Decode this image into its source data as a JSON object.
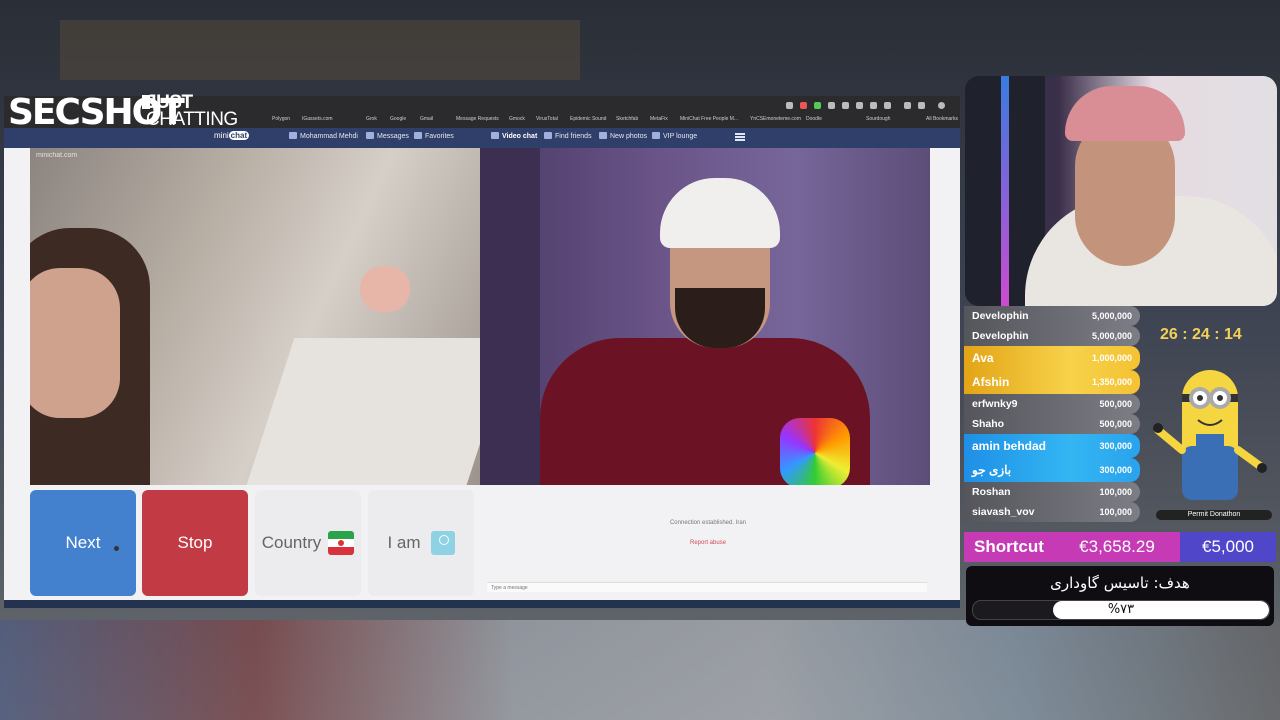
{
  "stream": {
    "logo_main": "SECSHOT",
    "logo_category_line1": "JUST",
    "logo_category_line2": "CHATTING"
  },
  "browser": {
    "bookmarks": [
      "Polygon",
      "IGassets.com",
      "Grok",
      "Google",
      "Gmail",
      "Message Requests",
      "Gmock",
      "VirusTotal",
      "Epidemic Sound",
      "Sketchfab",
      "MetaFix",
      "MiniChat Free People M...",
      "YnCSEmoneteme.com",
      "Doodle",
      "Sourdough",
      "All Bookmarks"
    ],
    "site_logo_pre": "mini",
    "site_logo_post": "chat",
    "nav": {
      "user": "Mohammad Mehdi",
      "messages": "Messages",
      "favorites": "Favorites",
      "video_chat": "Video chat",
      "find_friends": "Find friends",
      "new_photos": "New photos",
      "vip_lounge": "VIP lounge"
    },
    "watermark": "minichat.com",
    "controls": {
      "next": "Next",
      "stop": "Stop",
      "country": "Country",
      "iam": "I am"
    },
    "chat": {
      "status": "Connection established. Iran",
      "report": "Report abuse",
      "placeholder": "Type a message"
    }
  },
  "donors": [
    {
      "name": "Develophin",
      "amount": "5,000,000",
      "tier": "grey"
    },
    {
      "name": "Develophin",
      "amount": "5,000,000",
      "tier": "grey"
    },
    {
      "name": "Ava",
      "amount": "1,000,000",
      "tier": "gold"
    },
    {
      "name": "Afshin",
      "amount": "1,350,000",
      "tier": "gold"
    },
    {
      "name": "erfwnky9",
      "amount": "500,000",
      "tier": "grey"
    },
    {
      "name": "Shaho",
      "amount": "500,000",
      "tier": "grey"
    },
    {
      "name": "amin behdad",
      "amount": "300,000",
      "tier": "blue"
    },
    {
      "name": "بازی جو",
      "amount": "300,000",
      "tier": "blue"
    },
    {
      "name": "Roshan",
      "amount": "100,000",
      "tier": "grey"
    },
    {
      "name": "siavash_vov",
      "amount": "100,000",
      "tier": "grey"
    }
  ],
  "timer": "26 : 24 : 14",
  "marathon_label": "Permit Donathon",
  "shortcut": {
    "label": "Shortcut",
    "amount": "€3,658.29",
    "goal": "€5,000"
  },
  "goal": {
    "title": "هدف: تاسیس گاوداری",
    "percent_label": "%۷۳",
    "progress": 0.73
  },
  "colors": {
    "next_button": "#4381cf",
    "stop_button": "#c23a44",
    "site_nav": "#2f3f6a",
    "gold_donor": "#f2c232",
    "blue_donor": "#29a3ec",
    "shortcut_pink": "#c63ab6",
    "shortcut_purple": "#4f46c9",
    "timer_yellow": "#f3d05a"
  },
  "icons": [
    "messages-icon",
    "favorites-icon",
    "video-chat-icon",
    "search-icon",
    "photos-icon",
    "vip-icon",
    "menu-icon",
    "iran-flag-icon",
    "user-avatar-icon",
    "report-flag-icon",
    "minion-mascot"
  ]
}
